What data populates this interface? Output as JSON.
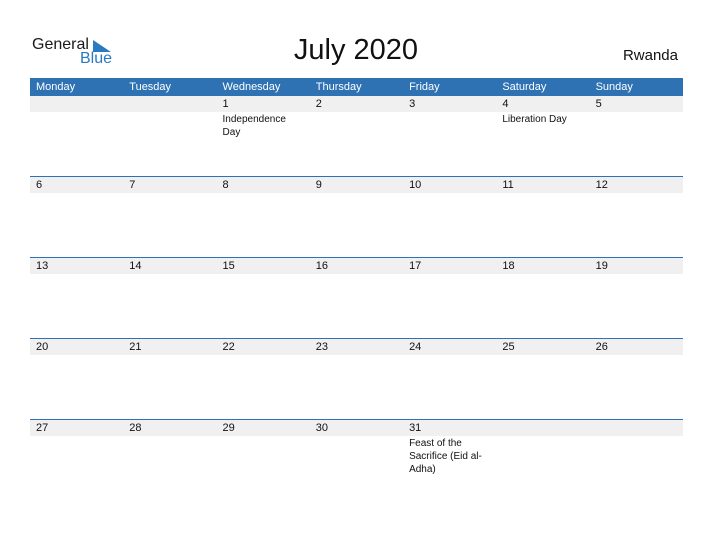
{
  "logo": {
    "text1": "General",
    "text2": "Blue"
  },
  "title": "July 2020",
  "country": "Rwanda",
  "colors": {
    "accent": "#2e72b4",
    "row_bg": "#f0f0f0"
  },
  "days": [
    "Monday",
    "Tuesday",
    "Wednesday",
    "Thursday",
    "Friday",
    "Saturday",
    "Sunday"
  ],
  "weeks": [
    {
      "dates": [
        "",
        "",
        "1",
        "2",
        "3",
        "4",
        "5"
      ],
      "events": [
        "",
        "",
        "Independence Day",
        "",
        "",
        "Liberation Day",
        ""
      ]
    },
    {
      "dates": [
        "6",
        "7",
        "8",
        "9",
        "10",
        "11",
        "12"
      ],
      "events": [
        "",
        "",
        "",
        "",
        "",
        "",
        ""
      ]
    },
    {
      "dates": [
        "13",
        "14",
        "15",
        "16",
        "17",
        "18",
        "19"
      ],
      "events": [
        "",
        "",
        "",
        "",
        "",
        "",
        ""
      ]
    },
    {
      "dates": [
        "20",
        "21",
        "22",
        "23",
        "24",
        "25",
        "26"
      ],
      "events": [
        "",
        "",
        "",
        "",
        "",
        "",
        ""
      ]
    },
    {
      "dates": [
        "27",
        "28",
        "29",
        "30",
        "31",
        "",
        ""
      ],
      "events": [
        "",
        "",
        "",
        "",
        "Feast of the Sacrifice (Eid al-Adha)",
        "",
        ""
      ]
    }
  ]
}
